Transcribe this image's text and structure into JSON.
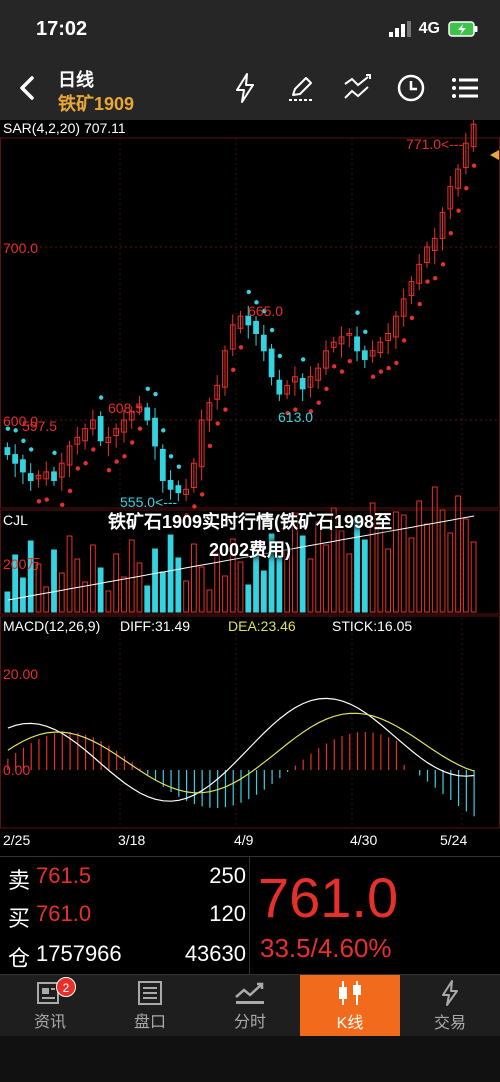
{
  "status": {
    "time": "17:02",
    "network": "4G"
  },
  "header": {
    "title": "日线",
    "subtitle": "铁矿1909"
  },
  "sar": {
    "label": "SAR(4,2,20)",
    "value": "707.11"
  },
  "price_axis": {
    "high_tag": "771.0<---",
    "y700": "700.0",
    "y600": "600.0"
  },
  "annotations": {
    "a597": "597.5",
    "a608": "608.5",
    "a665": "665.0",
    "a613": "613.0",
    "a555": "555.0<---"
  },
  "volume": {
    "label": "CJL",
    "y_label": "200万"
  },
  "macd": {
    "label": "MACD(12,26,9)",
    "diff": "DIFF:31.49",
    "dea": "DEA:23.46",
    "stick": "STICK:16.05",
    "y20": "20.00",
    "y0": "0.00"
  },
  "dates": [
    "2/25",
    "3/18",
    "4/9",
    "4/30",
    "5/24"
  ],
  "overlay": {
    "line1": "铁矿石1909实时行情(铁矿石1998至",
    "line2": "2002费用)"
  },
  "quote": {
    "sell_label": "卖",
    "sell_price": "761.5",
    "sell_vol": "250",
    "buy_label": "买",
    "buy_price": "761.0",
    "buy_vol": "120",
    "pos_label": "仓",
    "position": "1757966",
    "pos_change": "43630",
    "last_price": "761.0",
    "change": "33.5/4.60%"
  },
  "tabs": [
    {
      "label": "资讯",
      "badge": "2"
    },
    {
      "label": "盘口"
    },
    {
      "label": "分时"
    },
    {
      "label": "K线"
    },
    {
      "label": "交易"
    }
  ],
  "colors": {
    "up": "#e8302a",
    "down": "#35d3e0",
    "accent": "#f26a1b",
    "gold": "#e8a838"
  },
  "chart_data": {
    "type": "candlestick",
    "x_ticks": [
      "2/25",
      "3/18",
      "4/9",
      "4/30",
      "5/24"
    ],
    "price_ticks": [
      600.0,
      700.0
    ],
    "annotated_prices": [
      597.5,
      608.5,
      555.0,
      665.0,
      613.0,
      771.0
    ],
    "close": [
      580,
      575,
      570,
      565,
      568,
      570,
      565,
      575,
      585,
      590,
      595,
      600,
      588,
      590,
      595,
      600,
      605,
      608,
      600,
      585,
      565,
      560,
      558,
      560,
      575,
      600,
      610,
      620,
      640,
      655,
      660,
      655,
      650,
      640,
      625,
      615,
      620,
      625,
      618,
      625,
      630,
      640,
      645,
      648,
      650,
      640,
      635,
      640,
      645,
      650,
      660,
      670,
      680,
      690,
      700,
      705,
      720,
      735,
      745,
      760,
      771
    ],
    "sar_params": "SAR(4,2,20)",
    "sar_value": 707.11,
    "macd": {
      "params": "MACD(12,26,9)",
      "diff": 31.49,
      "dea": 23.46,
      "stick": 16.05,
      "y_ticks": [
        0.0,
        20.0
      ]
    },
    "volume_tick": "200万"
  }
}
